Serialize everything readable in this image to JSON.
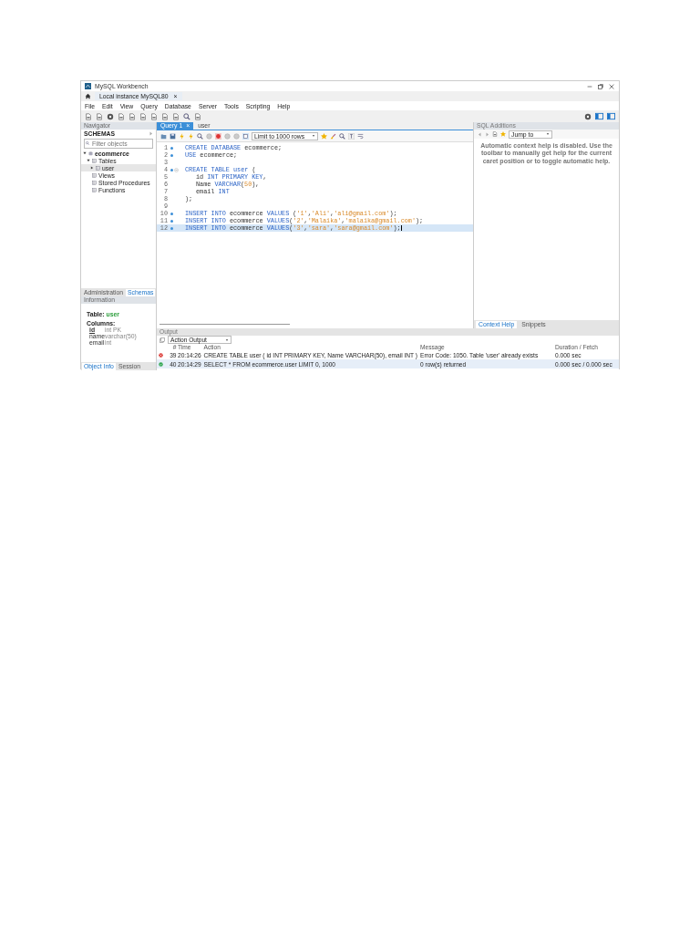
{
  "window": {
    "title": "MySQL Workbench"
  },
  "connection_tab": {
    "label": "Local instance MySQL80",
    "close": "×"
  },
  "menu": [
    "File",
    "Edit",
    "View",
    "Query",
    "Database",
    "Server",
    "Tools",
    "Scripting",
    "Help"
  ],
  "navigator": {
    "title": "Navigator",
    "section": "SCHEMAS",
    "filter": {
      "placeholder": "Filter objects"
    },
    "tree": [
      {
        "label": "ecommerce",
        "kind": "schema",
        "expanded": true,
        "children": [
          {
            "label": "Tables",
            "kind": "group",
            "expanded": true,
            "children": [
              {
                "label": "user",
                "kind": "table",
                "expanded": false
              }
            ]
          },
          {
            "label": "Views",
            "kind": "group"
          },
          {
            "label": "Stored Procedures",
            "kind": "group"
          },
          {
            "label": "Functions",
            "kind": "group"
          }
        ]
      }
    ],
    "tabs": [
      {
        "label": "Administration",
        "selected": false
      },
      {
        "label": "Schemas",
        "selected": true
      }
    ],
    "information": {
      "title": "Information",
      "table_label": "Table:",
      "table_name": "user",
      "columns_label": "Columns:",
      "columns": [
        {
          "name": "id",
          "type": "int PK",
          "key": true
        },
        {
          "name": "name",
          "type": "varchar(50)",
          "key": false
        },
        {
          "name": "email",
          "type": "int",
          "key": false
        }
      ]
    },
    "bottom_tabs": [
      {
        "label": "Object Info",
        "selected": true
      },
      {
        "label": "Session",
        "selected": false
      }
    ]
  },
  "editor": {
    "tabs": [
      {
        "label": "Query 1",
        "selected": true,
        "close": "×"
      },
      {
        "label": "user",
        "selected": false
      }
    ],
    "limit": "Limit to 1000 rows",
    "lines": [
      {
        "number": "1",
        "marker": true,
        "fold": false,
        "indent": false,
        "selected": false,
        "tokens": [
          {
            "kind": "kw",
            "t": "CREATE DATABASE"
          },
          {
            "kind": "id",
            "t": " ecommerce;"
          }
        ]
      },
      {
        "number": "2",
        "marker": true,
        "fold": false,
        "indent": false,
        "selected": false,
        "tokens": [
          {
            "kind": "kw",
            "t": "USE"
          },
          {
            "kind": "id",
            "t": " ecommerce;"
          }
        ]
      },
      {
        "number": "3",
        "marker": false,
        "fold": false,
        "selected": false
      },
      {
        "number": "4",
        "marker": true,
        "fold": true,
        "indent": false,
        "selected": false,
        "tokens": [
          {
            "kind": "kw",
            "t": "CREATE TABLE user"
          },
          {
            "kind": "id",
            "t": " ("
          }
        ]
      },
      {
        "number": "5",
        "marker": false,
        "fold": false,
        "indent": true,
        "selected": false,
        "tokens": [
          {
            "kind": "id",
            "t": "id "
          },
          {
            "kind": "kw",
            "t": "INT PRIMARY KEY"
          },
          {
            "kind": "id",
            "t": ","
          }
        ]
      },
      {
        "number": "6",
        "marker": false,
        "fold": false,
        "indent": true,
        "selected": false,
        "tokens": [
          {
            "kind": "id",
            "t": "Name "
          },
          {
            "kind": "kw",
            "t": "VARCHAR"
          },
          {
            "kind": "id",
            "t": "("
          },
          {
            "kind": "str",
            "t": "50"
          },
          {
            "kind": "id",
            "t": "),"
          }
        ]
      },
      {
        "number": "7",
        "marker": false,
        "fold": false,
        "indent": true,
        "selected": false,
        "tokens": [
          {
            "kind": "id",
            "t": "email "
          },
          {
            "kind": "kw",
            "t": "INT"
          }
        ]
      },
      {
        "number": "8",
        "marker": false,
        "fold": false,
        "indent": false,
        "selected": false,
        "tokens": [
          {
            "kind": "id",
            "t": ");"
          }
        ]
      },
      {
        "number": "9",
        "marker": false,
        "fold": false,
        "selected": false
      },
      {
        "number": "10",
        "marker": true,
        "fold": false,
        "indent": false,
        "selected": false,
        "tokens": [
          {
            "kind": "kw",
            "t": "INSERT INTO"
          },
          {
            "kind": "id",
            "t": " ecommerce "
          },
          {
            "kind": "kw",
            "t": "VALUES"
          },
          {
            "kind": "id",
            "t": " ("
          },
          {
            "kind": "str",
            "t": "'1'"
          },
          {
            "kind": "id",
            "t": ","
          },
          {
            "kind": "str",
            "t": "'Ali'"
          },
          {
            "kind": "id",
            "t": ","
          },
          {
            "kind": "str",
            "t": "'ali@gmail.com'"
          },
          {
            "kind": "id",
            "t": ");"
          }
        ]
      },
      {
        "number": "11",
        "marker": true,
        "fold": false,
        "indent": false,
        "selected": false,
        "tokens": [
          {
            "kind": "kw",
            "t": "INSERT INTO"
          },
          {
            "kind": "id",
            "t": " ecommerce "
          },
          {
            "kind": "kw",
            "t": "VALUES"
          },
          {
            "kind": "id",
            "t": "("
          },
          {
            "kind": "str",
            "t": "'2'"
          },
          {
            "kind": "id",
            "t": ","
          },
          {
            "kind": "str",
            "t": "'Malaika'"
          },
          {
            "kind": "id",
            "t": ","
          },
          {
            "kind": "str",
            "t": "'malaika@gmail.com'"
          },
          {
            "kind": "id",
            "t": ");"
          }
        ]
      },
      {
        "number": "12",
        "marker": true,
        "fold": false,
        "indent": false,
        "selected": true,
        "tokens": [
          {
            "kind": "kw",
            "t": "INSERT INTO"
          },
          {
            "kind": "id",
            "t": " ecommerce "
          },
          {
            "kind": "kw",
            "t": "VALUES"
          },
          {
            "kind": "id",
            "t": "("
          },
          {
            "kind": "str",
            "t": "'3'"
          },
          {
            "kind": "id",
            "t": ","
          },
          {
            "kind": "str",
            "t": "'sara'"
          },
          {
            "kind": "id",
            "t": ","
          },
          {
            "kind": "str",
            "t": "'sara@gmail.com'"
          },
          {
            "kind": "id",
            "t": ");"
          }
        ]
      }
    ]
  },
  "additions": {
    "title": "SQL Additions",
    "jump_to": "Jump to",
    "help": "Automatic context help is disabled. Use the toolbar to manually get help for the current caret position or to toggle automatic help.",
    "tabs": [
      {
        "label": "Context Help",
        "selected": true
      },
      {
        "label": "Snippets",
        "selected": false
      }
    ]
  },
  "output": {
    "title": "Output",
    "mode": "Action Output",
    "columns": [
      "#",
      "Time",
      "Action",
      "Message",
      "Duration / Fetch"
    ],
    "rows": [
      {
        "kind": "error",
        "number": "39",
        "time": "20:14:26",
        "action": "CREATE TABLE user (  id INT PRIMARY KEY,   Name VARCHAR(50),   email INT )",
        "message": "Error Code: 1050. Table 'user' already exists",
        "duration": "0.000 sec",
        "selected": false
      },
      {
        "kind": "ok",
        "number": "40",
        "time": "20:14:29",
        "action": "SELECT * FROM ecommerce.user LIMIT 0, 1000",
        "message": "0 row(s) returned",
        "duration": "0.000 sec / 0.000 sec",
        "selected": true
      }
    ]
  }
}
